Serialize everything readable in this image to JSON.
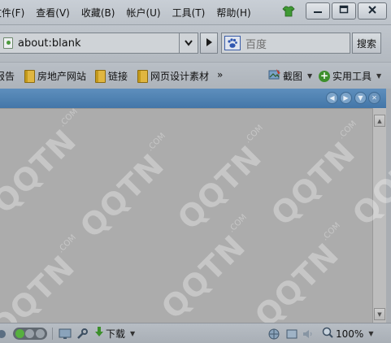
{
  "menu": {
    "items": [
      {
        "label": "文件(F)"
      },
      {
        "label": "查看(V)"
      },
      {
        "label": "收藏(B)"
      },
      {
        "label": "帐户(U)"
      },
      {
        "label": "工具(T)"
      },
      {
        "label": "帮助(H)"
      }
    ]
  },
  "window": {
    "minimize_icon": "minimize-icon",
    "maximize_icon": "maximize-icon",
    "close_icon": "close-icon",
    "skin_icon": "tshirt-icon"
  },
  "address": {
    "url": "about:blank"
  },
  "search": {
    "placeholder": "百度",
    "button_label": "搜索",
    "engine_icon": "baidu-paw-icon"
  },
  "bookmarks": {
    "items": [
      {
        "label": "报告"
      },
      {
        "label": "房地产网站"
      },
      {
        "label": "链接"
      },
      {
        "label": "网页设计素材"
      }
    ],
    "more": "»",
    "screenshot_label": "截图",
    "tools_label": "实用工具"
  },
  "status": {
    "download_label": "下载",
    "zoom": "100%"
  },
  "watermark": {
    "text": "QQTN",
    "suffix": ".COM"
  },
  "colors": {
    "strip": "#4d80b1",
    "content": "#acacac",
    "accent_green": "#3d8f2c"
  }
}
